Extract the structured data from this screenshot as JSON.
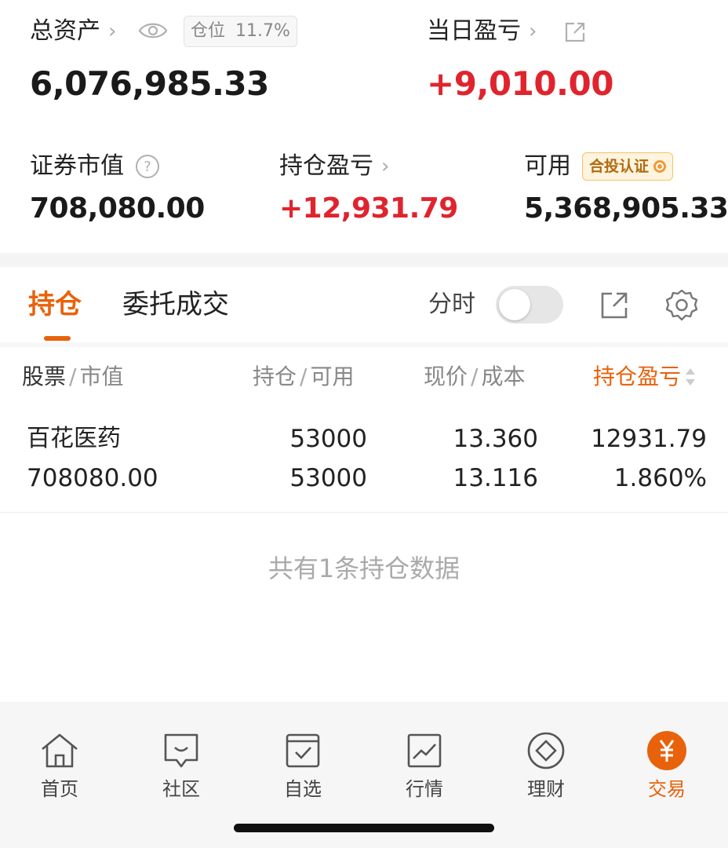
{
  "summary": {
    "total_assets_label": "总资产",
    "position_badge_label": "仓位",
    "position_badge_value": "11.7%",
    "total_assets_value": "6,076,985.33",
    "daily_pnl_label": "当日盈亏",
    "daily_pnl_value": "+9,010.00",
    "market_value_label": "证券市值",
    "market_value_value": "708,080.00",
    "holding_pnl_label": "持仓盈亏",
    "holding_pnl_value": "+12,931.79",
    "available_label": "可用",
    "certification_badge": "合投认证",
    "available_value": "5,368,905.33"
  },
  "tabs": {
    "holdings": "持仓",
    "orders": "委托成交",
    "timeshare_label": "分时",
    "timeshare_toggle_on": false
  },
  "table": {
    "headers": {
      "stock": "股票",
      "market_value": "市值",
      "holding": "持仓",
      "available": "可用",
      "price": "现价",
      "cost": "成本",
      "pnl": "持仓盈亏"
    },
    "rows": [
      {
        "name": "百花医药",
        "market_value": "708080.00",
        "holding": "53000",
        "available": "53000",
        "price": "13.360",
        "cost": "13.116",
        "pnl": "12931.79",
        "pnl_pct": "1.860%"
      }
    ],
    "footer": "共有1条持仓数据"
  },
  "nav": [
    {
      "label": "首页",
      "icon": "home-icon",
      "active": false
    },
    {
      "label": "社区",
      "icon": "community-icon",
      "active": false
    },
    {
      "label": "自选",
      "icon": "watchlist-icon",
      "active": false
    },
    {
      "label": "行情",
      "icon": "market-chart-icon",
      "active": false
    },
    {
      "label": "理财",
      "icon": "wealth-diamond-icon",
      "active": false
    },
    {
      "label": "交易",
      "icon": "trade-yuan-icon",
      "active": true
    }
  ],
  "colors": {
    "accent": "#e8620c",
    "gain_red": "#e0242e",
    "muted": "#888888"
  }
}
